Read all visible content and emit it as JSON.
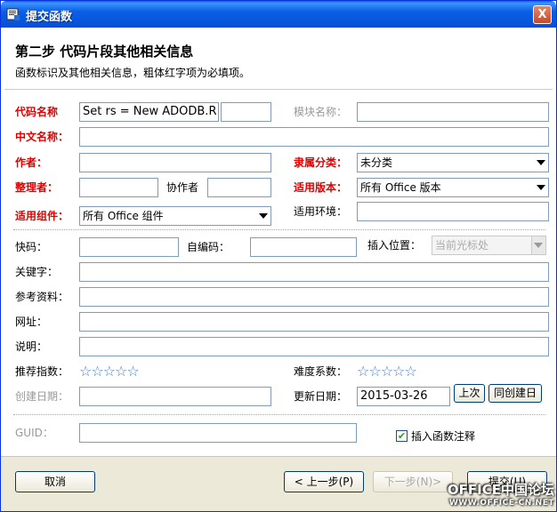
{
  "window": {
    "title": "提交函数",
    "close_label": "X"
  },
  "heading": {
    "title": "第二步 代码片段其他相关信息",
    "subtitle": "函数标识及其他相关信息，粗体红字项为必填项。"
  },
  "fields": {
    "code_name": {
      "label": "代码名称",
      "value": "Set rs = New ADODB.R",
      "extra": ""
    },
    "module_name": {
      "label": "模块名称：",
      "value": ""
    },
    "chinese_name": {
      "label": "中文名称：",
      "value": ""
    },
    "author": {
      "label": "作者：",
      "value": ""
    },
    "category": {
      "label": "隶属分类：",
      "value": "未分类"
    },
    "organizer": {
      "label": "整理者：",
      "value": ""
    },
    "coauthor": {
      "label": "协作者",
      "value": ""
    },
    "version": {
      "label": "适用版本：",
      "value": "所有 Office 版本"
    },
    "component": {
      "label": "适用组件：",
      "value": "所有 Office 组件"
    },
    "environment": {
      "label": "适用环境：",
      "value": ""
    },
    "shortcode": {
      "label": "快码：",
      "value": ""
    },
    "selfcode": {
      "label": "自编码：",
      "value": ""
    },
    "insert_pos": {
      "label": "插入位置：",
      "value": "当前光标处"
    },
    "keywords": {
      "label": "关键字：",
      "value": ""
    },
    "references": {
      "label": "参考资料：",
      "value": ""
    },
    "url": {
      "label": "网址：",
      "value": ""
    },
    "description": {
      "label": "说明：",
      "value": ""
    },
    "recommend": {
      "label": "推荐指数：",
      "stars": "☆☆☆☆☆",
      "rating": 0
    },
    "difficulty": {
      "label": "难度系数：",
      "stars": "☆☆☆☆☆",
      "rating": 0
    },
    "created": {
      "label": "创建日期：",
      "value": ""
    },
    "updated": {
      "label": "更新日期：",
      "value": "2015-03-26"
    },
    "guid": {
      "label": "GUID：",
      "value": ""
    }
  },
  "buttons": {
    "prev_time": "上次",
    "same_as_created": "同创建日",
    "cancel": "取消",
    "back": "< 上一步(P)",
    "next": "下一步(N)>",
    "submit": "提交(U)"
  },
  "checkbox": {
    "label": "插入函数注释",
    "checked": true,
    "mark": "✔"
  },
  "watermark": {
    "line1": "OFFICE中国论坛",
    "line2": "WWW.OFFICE-CN.NET"
  },
  "colors": {
    "required": "#e00000",
    "title_bar": "#0a5fe4",
    "star": "#4a7fc0"
  }
}
